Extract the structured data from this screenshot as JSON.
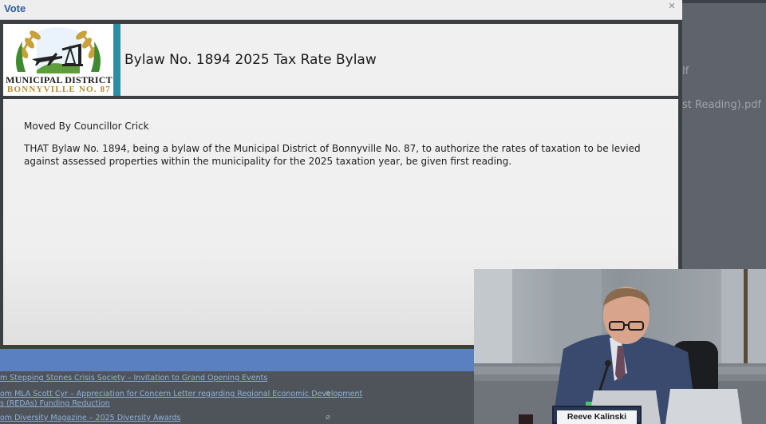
{
  "modal": {
    "title": "Vote",
    "close_icon": "close-icon"
  },
  "logo": {
    "line1": "MUNICIPAL DISTRICT",
    "line2": "BONNYVILLE NO. 87",
    "accent": "#2a8fa6"
  },
  "bylaw": {
    "title": "Bylaw No. 1894 2025 Tax Rate Bylaw"
  },
  "motion": {
    "moved_by": "Moved By Councillor Crick",
    "text": "THAT Bylaw No. 1894, being a bylaw of the Municipal District of Bonnyville No. 87, to authorize the rates of taxation to be levied against assessed properties within the municipality for the 2025 taxation year, be given first reading."
  },
  "background_files": [
    "lf",
    "st Reading).pdf"
  ],
  "agenda_items": [
    {
      "text": "m Stepping Stones Crisis Society – Invitation to Grand Opening Events"
    },
    {
      "text": "om MLA Scott Cyr – Appreciation for Concern Letter regarding Regional Economic Development"
    },
    {
      "text": "s (REDAs) Funding Reduction"
    },
    {
      "text": "om Diversity Magazine – 2025 Diversity Awards"
    }
  ],
  "video": {
    "nameplate": "Reeve Kalinski"
  },
  "colors": {
    "title_blue": "#2d5fa0",
    "bar_blue": "#5a80c2"
  }
}
